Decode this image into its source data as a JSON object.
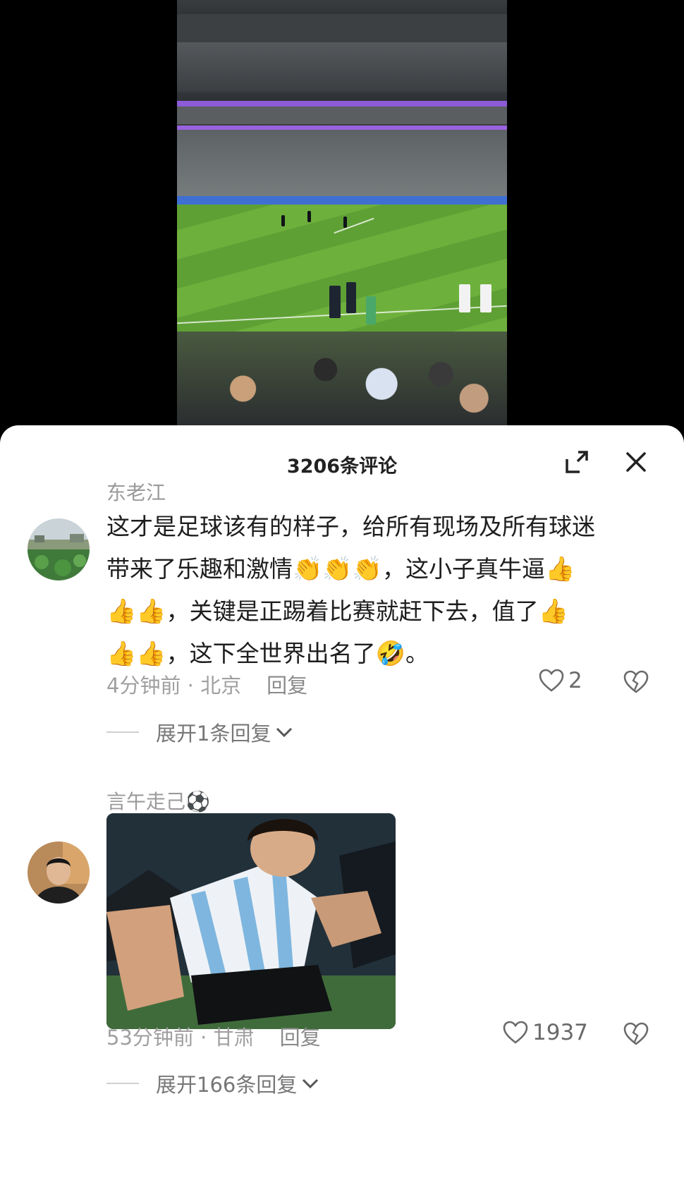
{
  "sheet": {
    "title": "3206条评论"
  },
  "icons": {
    "expand": "expand-icon",
    "close": "close-icon",
    "like": "heart-icon",
    "dislike": "broken-heart-icon",
    "chevron": "chevron-down-icon"
  },
  "comments": [
    {
      "username": "东老江",
      "text_parts": [
        "这才是足球该有的样子，给所有现场及所有球迷",
        "带来了乐趣和激情",
        "👏👏👏",
        "，这小子真牛逼",
        "👍",
        "👍👍",
        "，关键是正踢着比赛就赶下去，值了",
        "👍",
        "👍👍",
        "，这下全世界出名了",
        "🤣",
        "。"
      ],
      "time": "4分钟前",
      "separator": " · ",
      "location": "北京",
      "reply_label": "回复",
      "likes": "2",
      "expand_label": "展开1条回复"
    },
    {
      "username": "言午走己⚽",
      "has_image": true,
      "time": "53分钟前",
      "separator": " · ",
      "location": "甘肃",
      "reply_label": "回复",
      "likes": "1937",
      "expand_label": "展开166条回复"
    }
  ],
  "colors": {
    "sheet_bg": "#ffffff",
    "meta_gray": "#a0a0a0",
    "text_dark": "#1e1e1e"
  }
}
